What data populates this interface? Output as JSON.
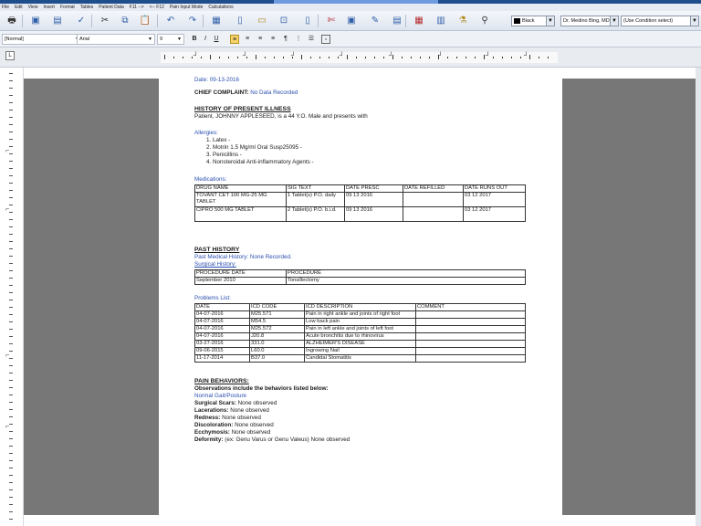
{
  "menu": [
    "File",
    "Edit",
    "View",
    "Insert",
    "Format",
    "Tables",
    "Patient Data",
    "F11 -->",
    "<-- F12",
    "Pain Input Mode",
    "Calculations"
  ],
  "toolbar": {
    "icons": [
      "print-icon",
      "save-icon",
      "print-preview-icon",
      "spell-check-icon",
      "cut-icon",
      "copy-icon",
      "paste-icon",
      "undo-icon",
      "redo-icon",
      "format-painter-icon",
      "new-document-icon",
      "open-document-icon",
      "insert-page-icon",
      "document-icon",
      "scissors-icon",
      "picture-icon",
      "pen-icon",
      "template-icon",
      "calendar-icon",
      "page-layout-icon",
      "lab-icon",
      "filter-icon"
    ],
    "color_value": "Black",
    "doctor_value": "Dr. Medino Bing, MD",
    "template_value": "(Use Condition select)"
  },
  "format": {
    "style_value": "[Normal]",
    "font_value": "Arial",
    "size_value": "9",
    "buttons": [
      "B",
      "I",
      "U"
    ]
  },
  "document": {
    "date_line": "Date: 09-13-2016",
    "chief_label": "CHIEF COMPLAINT:",
    "chief_value": "No Data Recorded",
    "hpi_heading": "HISTORY OF PRESENT ILLNESS",
    "hpi_text": "Patient, JOHNNY APPLESEED, is a 44 Y.O. Male and presents with",
    "allergies_label": "Allergies:",
    "allergies": [
      "1. Latex -",
      "2. Motrin 1.5 Mg/ml Oral Susp25095 -",
      "3. Penicillins -",
      "4. Nonsteroidal Anti-inflammatory Agents -"
    ],
    "medications_label": "Medications:",
    "med_headers": [
      "DRUG NAME",
      "SIG TEXT",
      "DATE PRESC",
      "DATE REFILLED",
      "DATE RUNS OUT"
    ],
    "med_rows": [
      [
        "TOVANT CET 100 MG-25 MG TABLET",
        "1 Tablet(s) P.O. daily",
        "09 13 2016",
        "",
        "03 12 2017"
      ],
      [
        "CIPRO 500 MG TABLET",
        "2 Tablet(s) P.O. b.i.d.",
        "09 13 2016",
        "",
        "03 12 2017"
      ]
    ],
    "past_heading": "PAST HISTORY",
    "past_medical_label": "Past Medical History:",
    "past_medical_value": "None Recorded.",
    "surgical_label": "Surgical History:",
    "surg_headers": [
      "PROCEDURE DATE",
      "PROCEDURE"
    ],
    "surg_rows": [
      [
        "September 2010",
        "Tonsillectomy"
      ]
    ],
    "problems_label": "Problems List:",
    "prob_headers": [
      "DATE",
      "ICD CODE",
      "ICD DESCRIPTION",
      "COMMENT"
    ],
    "prob_rows": [
      [
        "04-07-2016",
        "M25.571",
        "Pain in right ankle and joints of right foot",
        ""
      ],
      [
        "04-07-2016",
        "M54.5",
        "Low back pain",
        ""
      ],
      [
        "04-07-2016",
        "M25.572",
        "Pain in left ankle and joints of left foot",
        ""
      ],
      [
        "04-07-2016",
        "J20.8",
        "Acute bronchitis due to rhinovirus",
        ""
      ],
      [
        "03-27-2016",
        "331.0",
        "ALZHEIMER'S DISEASE",
        ""
      ],
      [
        "09-06-2015",
        "L60.0",
        "Ingrowing Nail",
        ""
      ],
      [
        "11-17-2014",
        "B37.0",
        "Candidal Stomatitis",
        ""
      ]
    ],
    "pain_heading": "PAIN BEHAVIORS:",
    "pain_intro": "Observations include the behaviors listed below:",
    "gait_label": "Normal Gait/Posture",
    "obs": [
      {
        "label": "Surgical Scars:",
        "value": "None observed"
      },
      {
        "label": "Lacerations:",
        "value": "None observed"
      },
      {
        "label": "Redness:",
        "value": "None observed"
      },
      {
        "label": "Discoloration:",
        "value": "None observed"
      },
      {
        "label": "Ecchymosis:",
        "value": "None observed"
      },
      {
        "label": "Deformity:",
        "value": "(ex: Genu Varus or Genu Valeus) None observed"
      }
    ]
  }
}
